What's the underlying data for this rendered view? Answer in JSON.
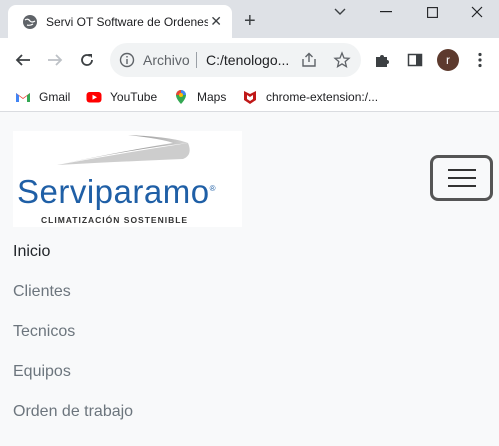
{
  "browser": {
    "tab_title": "Servi OT Software de Ordenes",
    "tab_close_glyph": "✕",
    "new_tab_glyph": "+",
    "address_scheme": "Archivo",
    "address_url": "C:/tenologo...",
    "profile_initial": "r"
  },
  "bookmarks": [
    {
      "label": "Gmail",
      "icon": "gmail-icon"
    },
    {
      "label": "YouTube",
      "icon": "youtube-icon"
    },
    {
      "label": "Maps",
      "icon": "maps-icon"
    },
    {
      "label": "chrome-extension:/...",
      "icon": "mcafee-icon"
    }
  ],
  "logo": {
    "brand": "Serviparamo",
    "registered": "®",
    "tagline": "CLIMATIZACIÓN SOSTENIBLE"
  },
  "nav": {
    "items": [
      {
        "label": "Inicio",
        "active": true
      },
      {
        "label": "Clientes",
        "active": false
      },
      {
        "label": "Tecnicos",
        "active": false
      },
      {
        "label": "Equipos",
        "active": false
      },
      {
        "label": "Orden de trabajo",
        "active": false
      }
    ]
  },
  "colors": {
    "brand_blue": "#1f5fa6",
    "nav_active": "#212529",
    "nav_muted": "#6c757d"
  }
}
